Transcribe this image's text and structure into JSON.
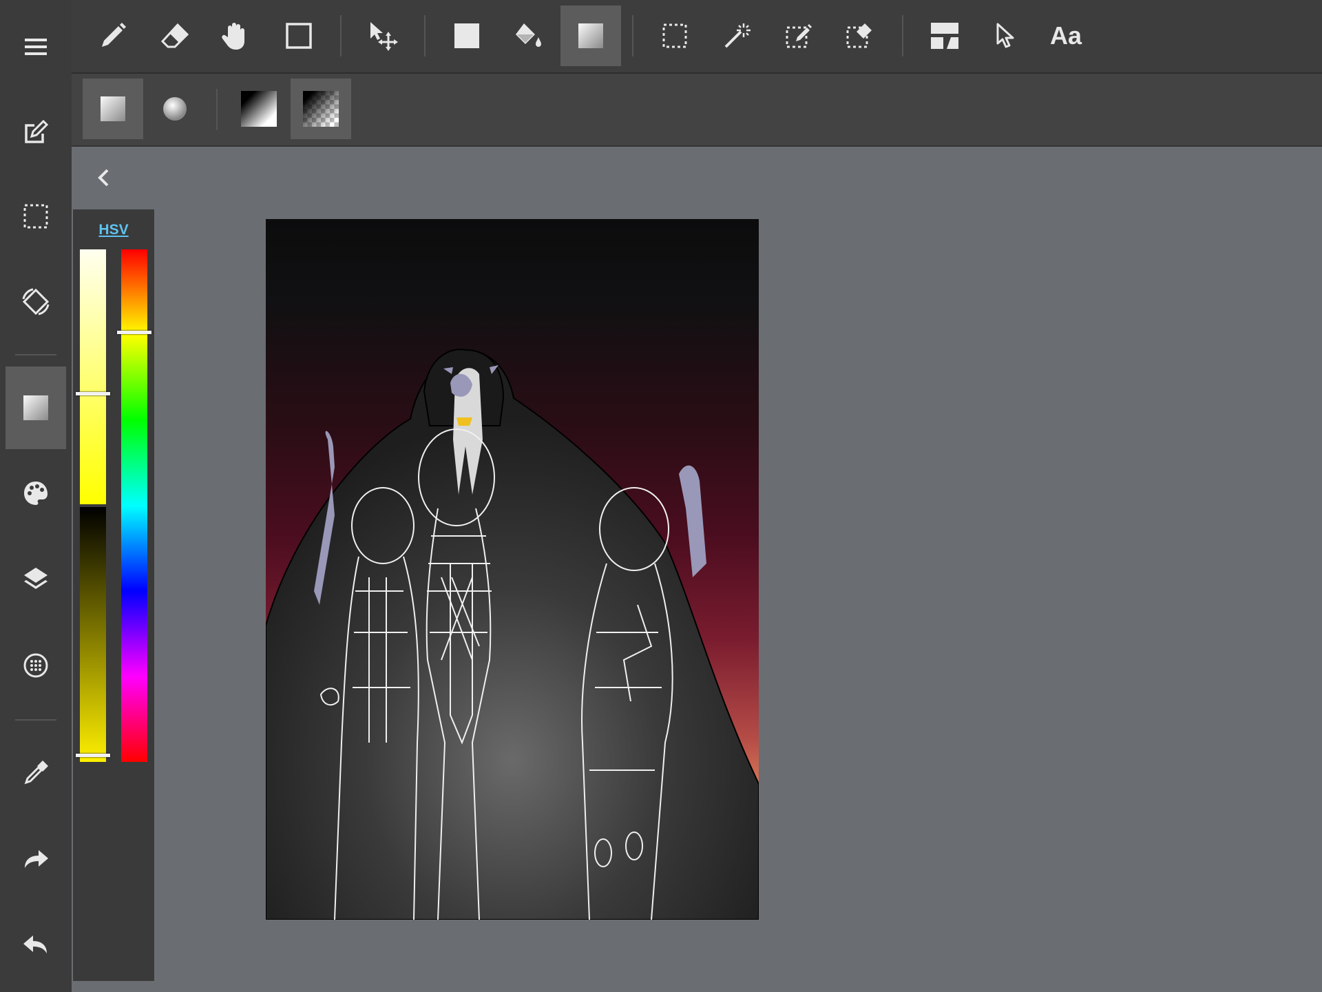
{
  "colors": {
    "sidebar_bg": "#3b3b3b",
    "topbar_bg": "#3d3d3d",
    "subbar_bg": "#434343",
    "workspace_bg": "#6a6d72",
    "active_bg": "#5c5c5c",
    "hsv_link": "#5ec3f2",
    "icon": "#e8e8e8"
  },
  "sidebar": {
    "items": [
      {
        "icon": "menu-icon"
      },
      {
        "icon": "edit-canvas-icon"
      },
      {
        "icon": "selection-icon"
      },
      {
        "icon": "rotate-screen-icon"
      },
      {
        "icon": "gradient-tool-icon",
        "active": true
      },
      {
        "icon": "palette-icon"
      },
      {
        "icon": "layers-icon"
      },
      {
        "icon": "material-icon"
      },
      {
        "icon": "eyedropper-icon"
      },
      {
        "icon": "redo-icon"
      },
      {
        "icon": "undo-icon"
      }
    ]
  },
  "toolbar": {
    "tools": [
      {
        "icon": "pen-icon"
      },
      {
        "icon": "eraser-icon"
      },
      {
        "icon": "hand-icon"
      },
      {
        "icon": "shape-icon"
      },
      {
        "icon": "move-icon"
      },
      {
        "icon": "fill-icon"
      },
      {
        "icon": "bucket-icon"
      },
      {
        "icon": "gradient-icon",
        "active": true
      },
      {
        "icon": "select-icon"
      },
      {
        "icon": "magic-wand-icon"
      },
      {
        "icon": "select-pen-icon"
      },
      {
        "icon": "select-eraser-icon"
      },
      {
        "icon": "divide-frame-icon"
      },
      {
        "icon": "operation-icon"
      }
    ],
    "text_tool_label": "Aa"
  },
  "subtoolbar": {
    "items": [
      {
        "icon": "linear-gradient-icon",
        "active": true
      },
      {
        "icon": "radial-gradient-icon"
      },
      {
        "icon": "fg-to-bg-gradient-icon"
      },
      {
        "icon": "fg-to-transparent-gradient-icon",
        "active": true
      }
    ]
  },
  "color_panel": {
    "mode_label": "HSV",
    "saturation": 0.57,
    "value": 0.99,
    "hue_degrees": 60
  }
}
